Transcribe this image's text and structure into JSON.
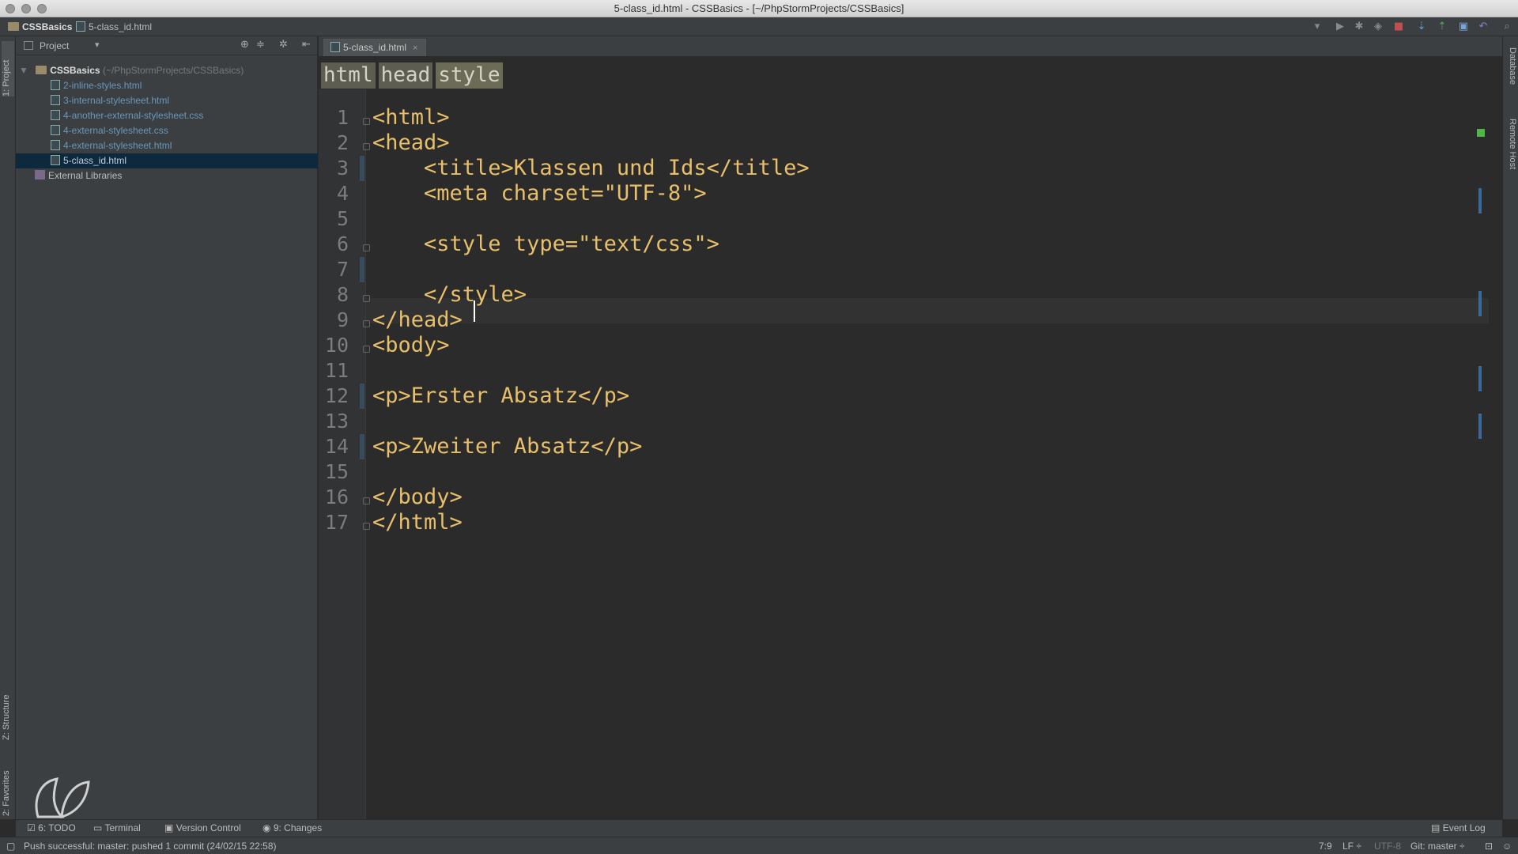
{
  "window": {
    "title": "5-class_id.html - CSSBasics - [~/PhpStormProjects/CSSBasics]"
  },
  "navbar": {
    "project": "CSSBasics",
    "file": "5-class_id.html"
  },
  "left_strip": {
    "project_tab": "1: Project",
    "structure_tab": "Z: Structure",
    "favorites_tab": "2: Favorites"
  },
  "right_strip": {
    "database_tab": "Database",
    "remote_tab": "Remote Host"
  },
  "project_panel": {
    "title": "Project",
    "root": {
      "name": "CSSBasics",
      "path": "(~/PhpStormProjects/CSSBasics)"
    },
    "files": [
      {
        "name": "2-inline-styles.html"
      },
      {
        "name": "3-internal-stylesheet.html"
      },
      {
        "name": "4-another-external-stylesheet.css"
      },
      {
        "name": "4-external-stylesheet.css"
      },
      {
        "name": "4-external-stylesheet.html"
      },
      {
        "name": "5-class_id.html",
        "selected": true
      }
    ],
    "libraries": "External Libraries"
  },
  "editor": {
    "tab": "5-class_id.html",
    "breadcrumbs": [
      "html",
      "head",
      "style"
    ],
    "lines": [
      {
        "n": "1",
        "code": "<html>"
      },
      {
        "n": "2",
        "code": "<head>"
      },
      {
        "n": "3",
        "code": "    <title>Klassen und Ids</title>"
      },
      {
        "n": "4",
        "code": "    <meta charset=\"UTF-8\">"
      },
      {
        "n": "5",
        "code": ""
      },
      {
        "n": "6",
        "code": "    <style type=\"text/css\">"
      },
      {
        "n": "7",
        "code": ""
      },
      {
        "n": "8",
        "code": "    </style>"
      },
      {
        "n": "9",
        "code": "</head>"
      },
      {
        "n": "10",
        "code": "<body>"
      },
      {
        "n": "11",
        "code": ""
      },
      {
        "n": "12",
        "code": "<p>Erster Absatz</p>"
      },
      {
        "n": "13",
        "code": ""
      },
      {
        "n": "14",
        "code": "<p>Zweiter Absatz</p>"
      },
      {
        "n": "15",
        "code": ""
      },
      {
        "n": "16",
        "code": "</body>"
      },
      {
        "n": "17",
        "code": "</html>"
      }
    ]
  },
  "toolwindows": {
    "todo": "6: TODO",
    "terminal": "Terminal",
    "vcs": "Version Control",
    "changes": "9: Changes",
    "eventlog": "Event Log"
  },
  "status": {
    "message": "Push successful: master: pushed 1 commit (24/02/15 22:58)",
    "position": "7:9",
    "line_sep": "LF ÷",
    "encoding": "UTF-8",
    "git": "Git: master ÷"
  }
}
